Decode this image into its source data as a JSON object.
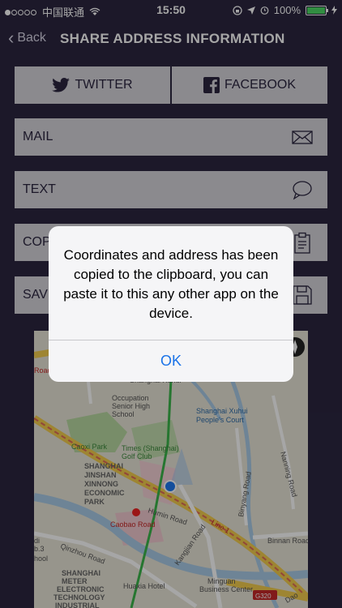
{
  "status": {
    "carrier": "中国联通",
    "time": "15:50",
    "battery": "100%"
  },
  "nav": {
    "back_label": "Back",
    "title": "SHARE ADDRESS INFORMATION"
  },
  "share": {
    "twitter_label": "TWITTER",
    "facebook_label": "FACEBOOK",
    "mail_label": "MAIL",
    "text_label": "TEXT",
    "copy_label": "COP",
    "save_label": "SAV"
  },
  "map": {
    "labels": {
      "shanghai_xuhui_school": "Shanghai Xuhui",
      "occupation": "Occupation",
      "senior_high": "Senior High",
      "school": "School",
      "people_court_1": "Shanghai Xuhui",
      "people_court_2": "People's Court",
      "caoxi_park": "Caoxi Park",
      "golf_club_1": "Times (Shanghai)",
      "golf_club_2": "Golf Club",
      "jinshan_1": "SHANGHAI",
      "jinshan_2": "JINSHAN",
      "jinshan_3": "XINNONG",
      "jinshan_4": "ECONOMIC",
      "jinshan_5": "PARK",
      "humin_road": "Humin Road",
      "caobao_road": "Caobao Road",
      "qinzhou_road": "Qinzhou Road",
      "huaxia_hotel": "Huaxia Hotel",
      "kangjian_road": "Kangjian Road",
      "binyang_road": "Binyang Road",
      "minguan_1": "Minguan",
      "minguan_2": "Business Center",
      "binnan_road": "Binnan Road",
      "nanning_road": "Nanning Road",
      "line1": "Line 1",
      "meter_1": "SHANGHAI",
      "meter_2": "METER",
      "meter_3": "ELECTRONIC",
      "meter_4": "TECHNOLOGY",
      "meter_5": "INDUSTRIAL",
      "g320": "G320",
      "road_left": "Road",
      "hool": "hool",
      "b3": "b.3",
      "di": "di",
      "dao": "Dao"
    }
  },
  "alert": {
    "message": "Coordinates and address has been copied to the clipboard, you can paste it to this any other app on the device.",
    "ok_label": "OK"
  },
  "colors": {
    "background": "#2b2640",
    "button": "#d6d4da",
    "link_blue": "#1a73e8"
  }
}
